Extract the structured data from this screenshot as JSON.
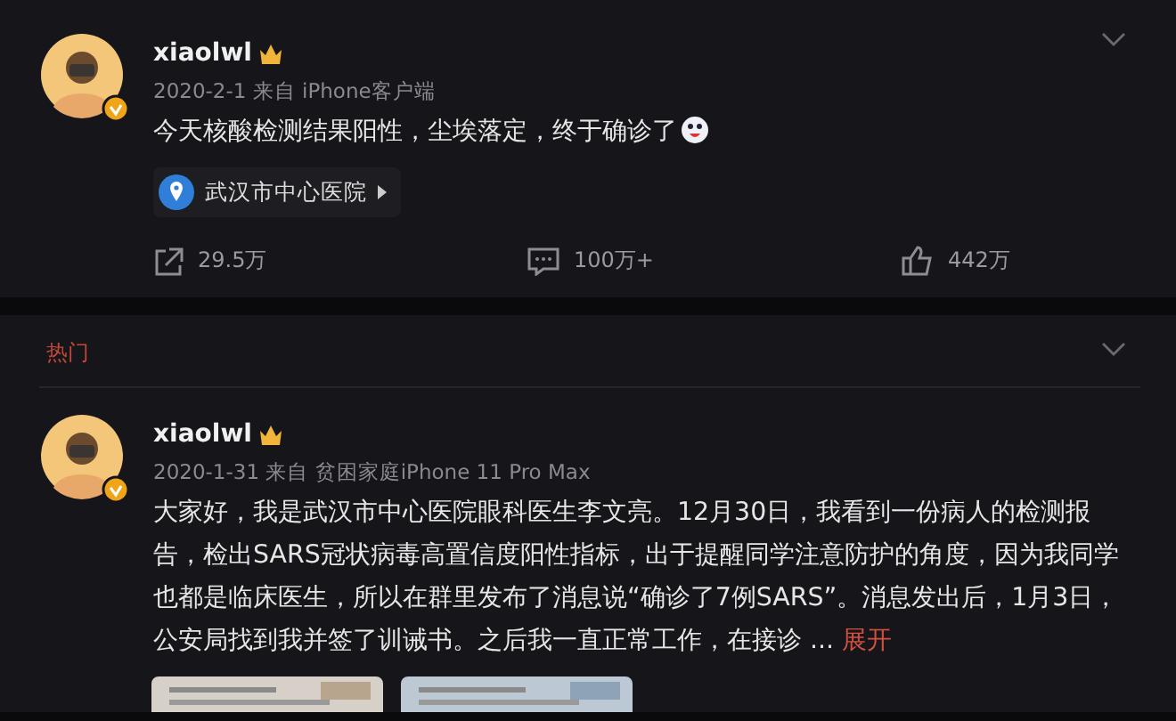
{
  "posts": [
    {
      "username": "xiaolwl",
      "verified": true,
      "meta": "2020-2-1 来自 iPhone客户端",
      "text": "今天核酸检测结果阳性，尘埃落定，终于确诊了",
      "emoji": true,
      "location": "武汉市中心医院",
      "stats": [
        {
          "kind": "share",
          "count": "29.5万"
        },
        {
          "kind": "comment",
          "count": "100万+"
        },
        {
          "kind": "like",
          "count": "442万"
        }
      ]
    },
    {
      "section": "热门",
      "username": "xiaolwl",
      "verified": true,
      "meta": "2020-1-31 来自 贫困家庭iPhone 11 Pro Max",
      "text": "大家好，我是武汉市中心医院眼科医生李文亮。12月30日，我看到一份病人的检测报告，检出SARS冠状病毒高置信度阳性指标，出于提醒同学注意防护的角度，因为我同学也都是临床医生，所以在群里发布了消息说“确诊了7例SARS”。消息发出后，1月3日，公安局找到我并签了训诫书。之后我一直正常工作，在接诊",
      "ellipsis": "...",
      "expand": "展开"
    }
  ]
}
